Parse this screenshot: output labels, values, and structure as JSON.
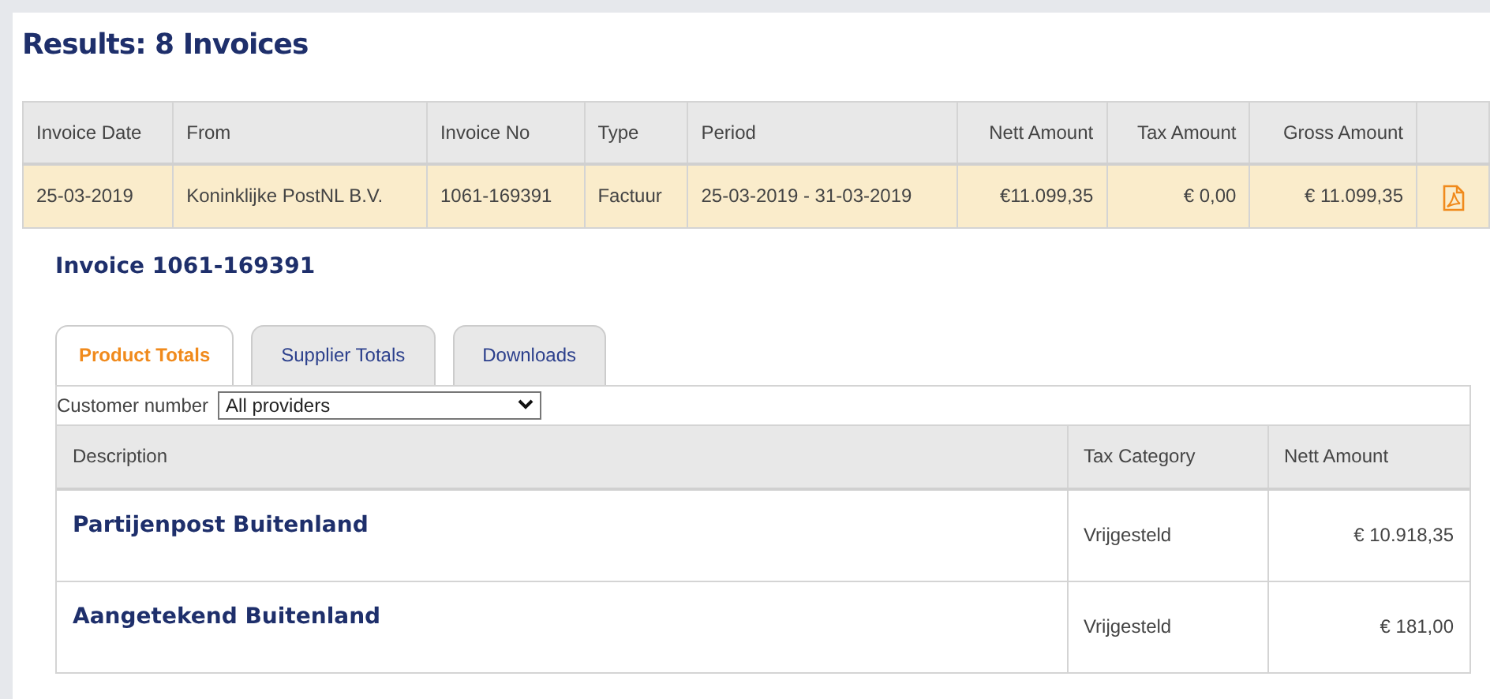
{
  "title": "Results: 8 Invoices",
  "invoices": {
    "columns": [
      "Invoice Date",
      "From",
      "Invoice No",
      "Type",
      "Period",
      "Nett Amount",
      "Tax Amount",
      "Gross Amount"
    ],
    "rows": [
      {
        "selected": true,
        "cells": [
          "25-03-2019",
          "Koninklijke PostNL B.V.",
          "1061-169391",
          "Factuur",
          "25-03-2019 - 31-03-2019",
          "€11.099,35",
          "€ 0,00",
          "€ 11.099,35"
        ]
      }
    ]
  },
  "detail": {
    "title": "Invoice 1061-169391",
    "tabs": [
      {
        "label": "Product Totals",
        "selected": true
      },
      {
        "label": "Supplier Totals",
        "selected": false
      },
      {
        "label": "Downloads",
        "selected": false
      }
    ],
    "filter": {
      "label": "Customer number",
      "value": "All providers"
    },
    "columns": [
      "Description",
      "Tax Category",
      "Nett Amount"
    ],
    "rows": [
      {
        "description": "Partijenpost Buitenland",
        "tax_category": "Vrijgesteld",
        "nett_amount": "€ 10.918,35"
      },
      {
        "description": "Aangetekend Buitenland",
        "tax_category": "Vrijgesteld",
        "nett_amount": "€ 181,00"
      }
    ]
  }
}
